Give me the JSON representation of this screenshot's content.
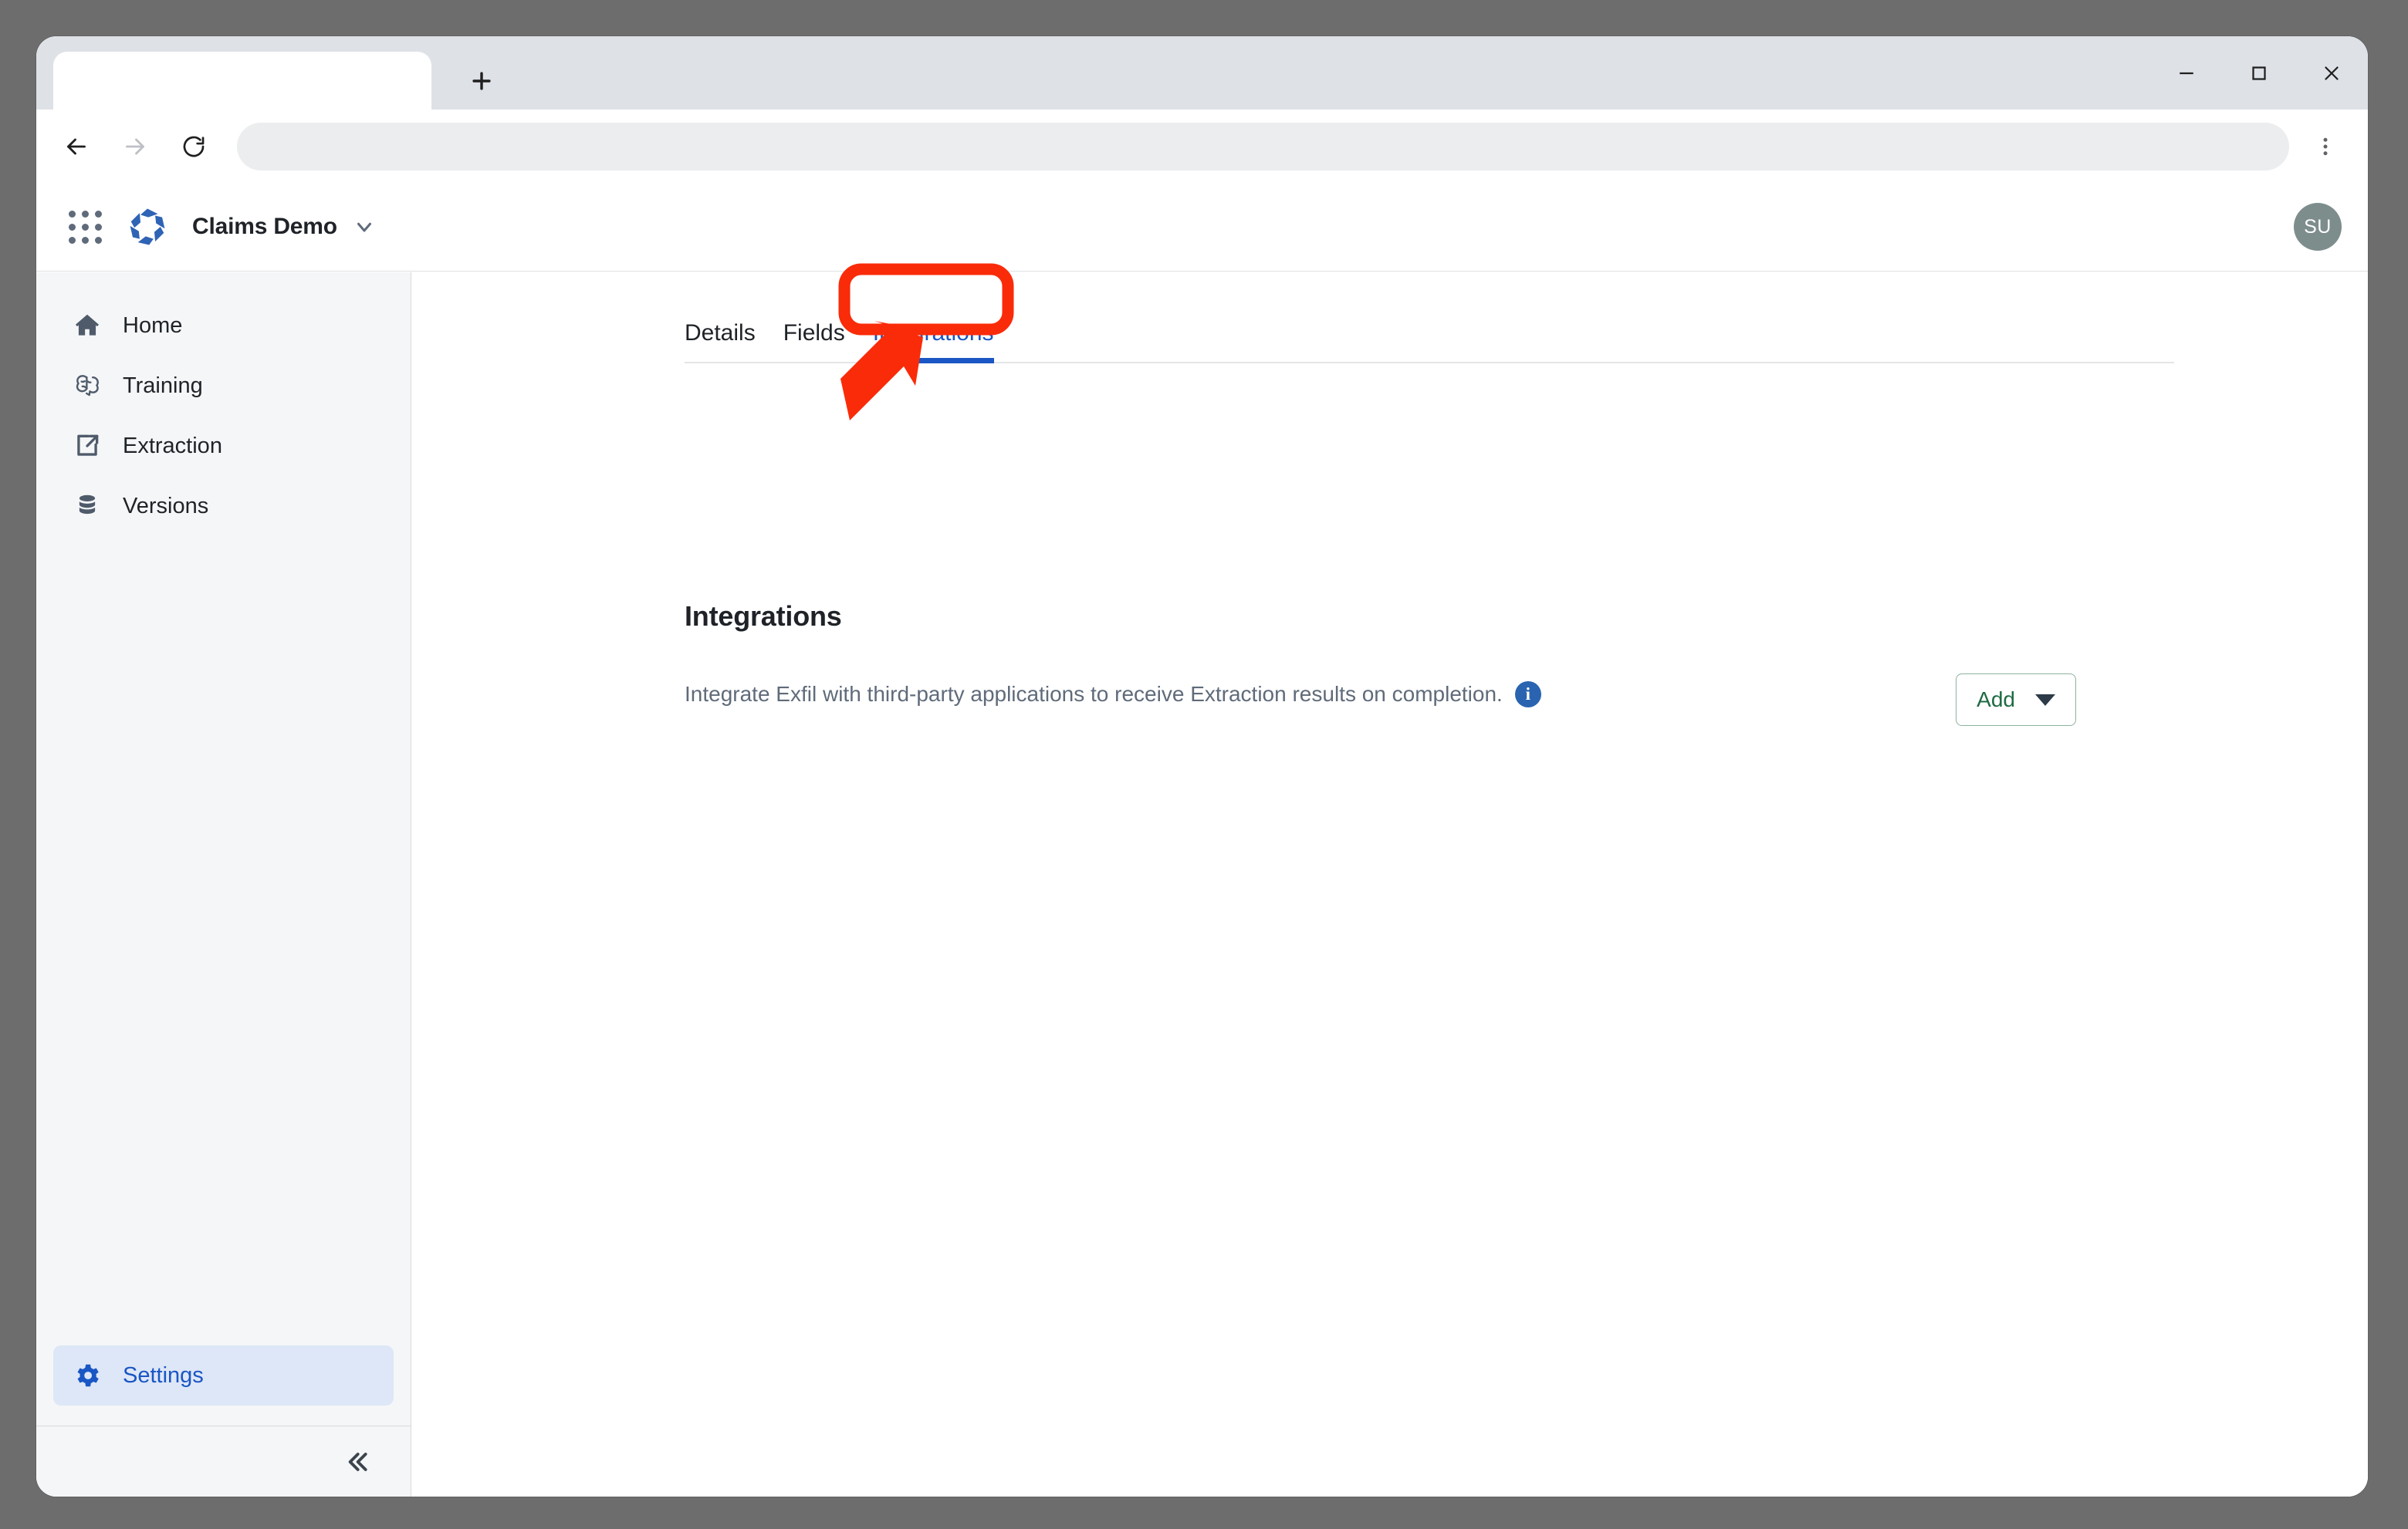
{
  "browser": {
    "tab": {
      "title": "",
      "name": "browser-tab"
    },
    "new_tab_label": "+",
    "address_value": "",
    "address_placeholder": "",
    "controls": {
      "minimize": "—",
      "maximize": "□",
      "close": "✕"
    },
    "nav": {
      "back": "←",
      "forward": "→",
      "reload": "↻",
      "menu": "⋮"
    }
  },
  "appheader": {
    "brand_name": "Claims Demo",
    "avatar_initials": "SU"
  },
  "sidebar": {
    "items": [
      {
        "label": "Home",
        "icon": "home-icon",
        "active": false
      },
      {
        "label": "Training",
        "icon": "brain-icon",
        "active": false
      },
      {
        "label": "Extraction",
        "icon": "extraction-icon",
        "active": false
      },
      {
        "label": "Versions",
        "icon": "database-icon",
        "active": false
      }
    ],
    "settings": {
      "label": "Settings",
      "icon": "gear-icon",
      "active": true
    },
    "collapse_label": "«"
  },
  "content": {
    "tabs": [
      {
        "label": "Details",
        "active": false
      },
      {
        "label": "Fields",
        "active": false
      },
      {
        "label": "Integrations",
        "active": true
      }
    ],
    "heading": "Integrations",
    "description": "Integrate Exfil with third-party applications to receive Extraction results on completion.",
    "info_glyph": "i",
    "add_label": "Add"
  },
  "annotation": {
    "highlight_color": "#fa2b09",
    "highlight_target": "Integrations",
    "arrow": "pointer-arrow"
  },
  "colors": {
    "accent_blue": "#1a56c4",
    "sidebar_bg": "#f5f6f7",
    "add_green": "#1d6b43",
    "avatar_bg": "#7d8d8c",
    "desk_bg": "#6d6d6d"
  }
}
